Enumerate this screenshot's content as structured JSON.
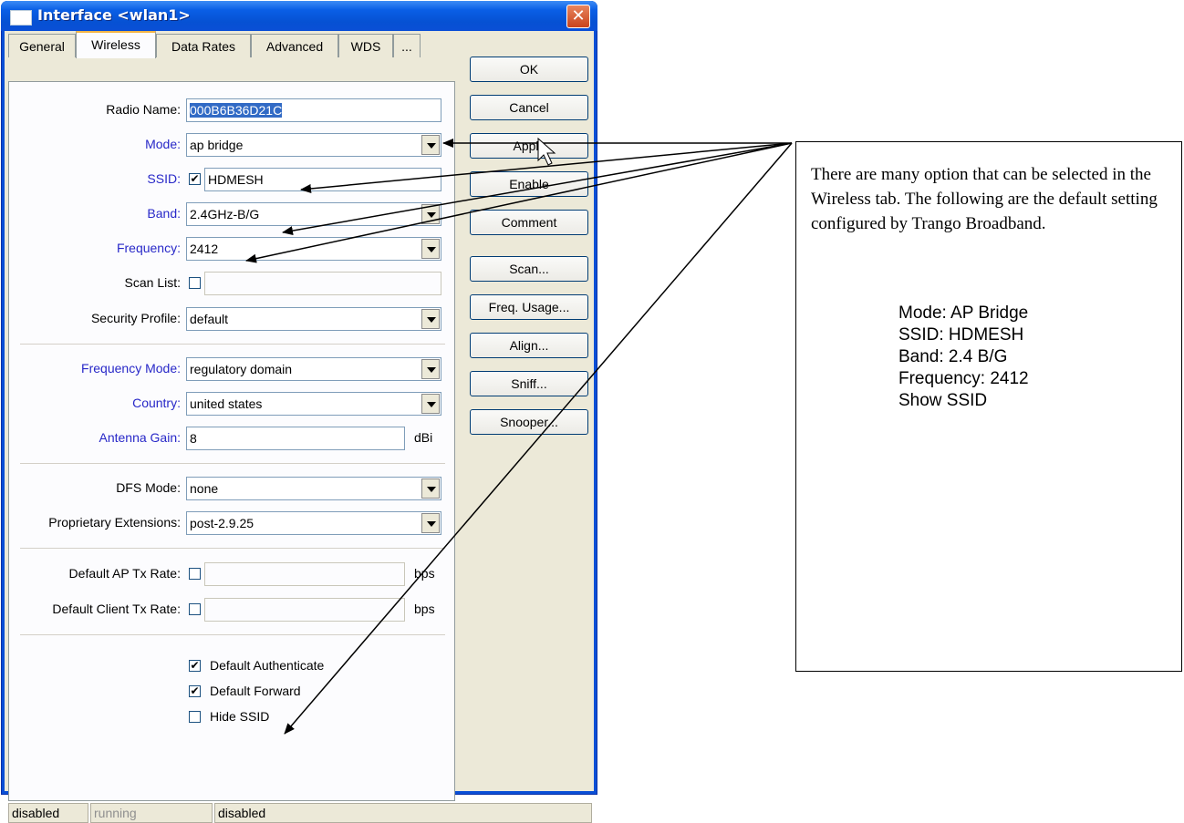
{
  "window": {
    "title": "Interface <wlan1>",
    "close_glyph": "✕"
  },
  "tabs": [
    "General",
    "Wireless",
    "Data Rates",
    "Advanced",
    "WDS",
    "..."
  ],
  "form": {
    "radio_name": {
      "label": "Radio Name:",
      "value": "000B6B36D21C"
    },
    "mode": {
      "label": "Mode:",
      "value": "ap bridge"
    },
    "ssid": {
      "label": "SSID:",
      "value": "HDMESH",
      "checked": true
    },
    "band": {
      "label": "Band:",
      "value": "2.4GHz-B/G"
    },
    "frequency": {
      "label": "Frequency:",
      "value": "2412"
    },
    "scan_list": {
      "label": "Scan List:",
      "value": ""
    },
    "security_profile": {
      "label": "Security Profile:",
      "value": "default"
    },
    "frequency_mode": {
      "label": "Frequency Mode:",
      "value": "regulatory domain"
    },
    "country": {
      "label": "Country:",
      "value": "united states"
    },
    "antenna_gain": {
      "label": "Antenna Gain:",
      "value": "8",
      "unit": "dBi"
    },
    "dfs_mode": {
      "label": "DFS Mode:",
      "value": "none"
    },
    "proprietary_extensions": {
      "label": "Proprietary Extensions:",
      "value": "post-2.9.25"
    },
    "default_ap_tx_rate": {
      "label": "Default AP Tx Rate:",
      "value": "",
      "unit": "bps"
    },
    "default_client_tx_rate": {
      "label": "Default Client Tx Rate:",
      "value": "",
      "unit": "bps"
    },
    "default_authenticate": {
      "label": "Default Authenticate",
      "checked": true
    },
    "default_forward": {
      "label": "Default Forward",
      "checked": true
    },
    "hide_ssid": {
      "label": "Hide SSID",
      "checked": false
    }
  },
  "buttons": [
    "OK",
    "Cancel",
    "Apply",
    "Enable",
    "Comment",
    "Scan...",
    "Freq. Usage...",
    "Align...",
    "Sniff...",
    "Snooper..."
  ],
  "status_bar": [
    "disabled",
    "running",
    "disabled"
  ],
  "note": {
    "text": "There are many option that can be selected in the Wireless tab. The following are the default setting configured by Trango Broadband.",
    "items": [
      "Mode: AP Bridge",
      "SSID: HDMESH",
      "Band: 2.4 B/G",
      "Frequency: 2412",
      "Show SSID"
    ]
  },
  "colors": {
    "title_bar": "#0a4fd6",
    "blue_label": "#2828c8",
    "selection": "#316ac5"
  }
}
